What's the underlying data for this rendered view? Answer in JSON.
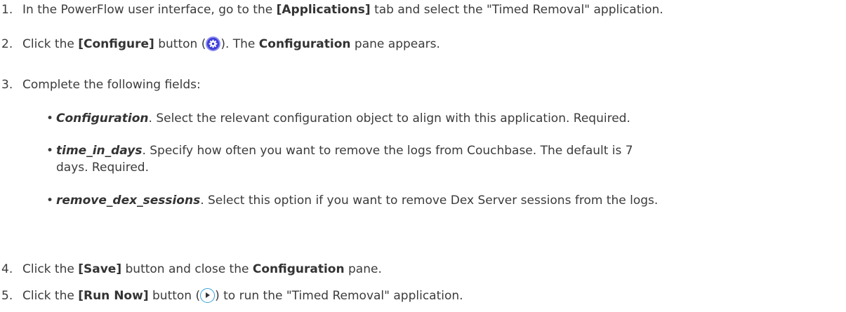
{
  "steps": [
    {
      "num": "1.",
      "t1": "In the PowerFlow user interface, go to the ",
      "b1": "[Applications]",
      "t2": " tab and select the \"Timed Removal\" application."
    },
    {
      "num": "2.",
      "t1": "Click the ",
      "b1": "[Configure]",
      "t2": " button (",
      "icon": "gear-icon",
      "t3": "). The ",
      "b2": "Configuration",
      "t4": " pane appears."
    },
    {
      "num": "3.",
      "t1": "Complete the following fields:"
    },
    {
      "num": "4.",
      "t1": "Click the ",
      "b1": "[Save]",
      "t2": " button and close the ",
      "b2": "Configuration",
      "t3": " pane."
    },
    {
      "num": "5.",
      "t1": "Click the ",
      "b1": "[Run Now]",
      "t2": " button (",
      "icon": "play-icon",
      "t3": ") to run the \"Timed Removal\" application."
    }
  ],
  "fields": [
    {
      "name": "Configuration",
      "desc": ". Select the relevant configuration object to align with this application. Required."
    },
    {
      "name": "time_in_days",
      "desc": ". Specify how often you want to remove the logs from Couchbase. The default is 7",
      "desc2": "days. Required."
    },
    {
      "name": "remove_dex_sessions",
      "desc": ". Select this option if you want to remove Dex Server sessions from the logs."
    }
  ],
  "bullet_char": "•",
  "colors": {
    "text": "#3b3b3b",
    "configure_icon": "#3b3bd6",
    "run_icon_border": "#3aa0dc"
  }
}
